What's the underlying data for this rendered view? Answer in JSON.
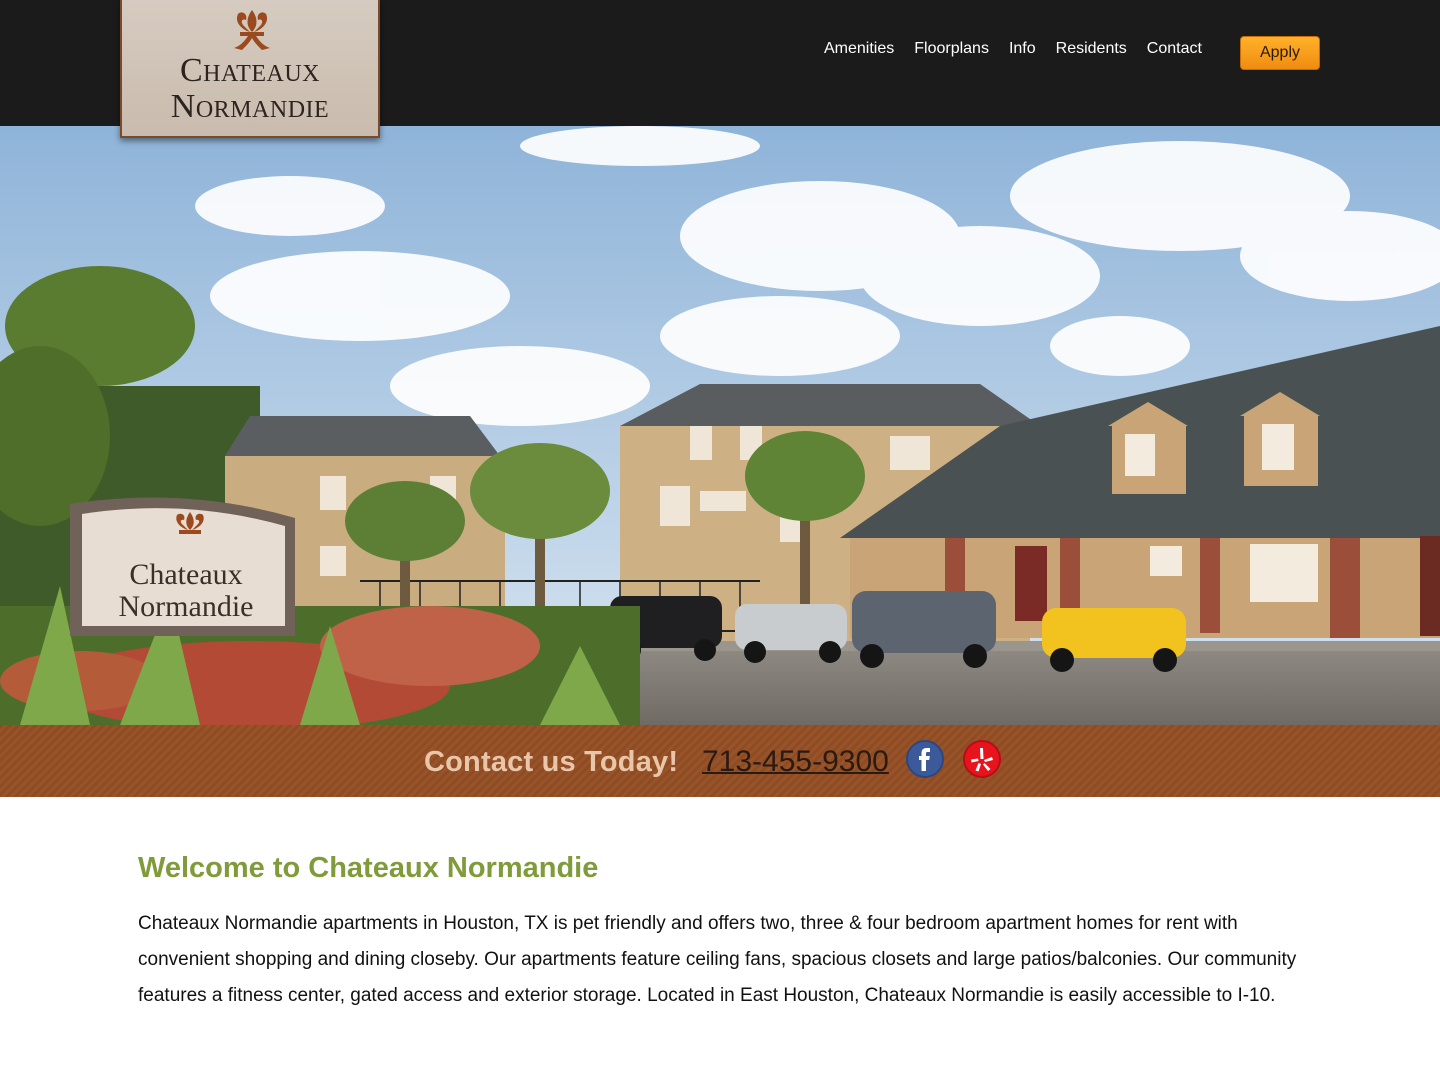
{
  "header": {
    "logo": {
      "line1": "Chateaux",
      "line2": "Normandie"
    },
    "nav": [
      {
        "label": "Amenities"
      },
      {
        "label": "Floorplans"
      },
      {
        "label": "Info"
      },
      {
        "label": "Residents"
      },
      {
        "label": "Contact"
      }
    ],
    "apply_label": "Apply"
  },
  "hero": {
    "sign_line1": "Chateaux",
    "sign_line2": "Normandie"
  },
  "contact": {
    "text": "Contact us Today!",
    "phone": "713-455-9300",
    "social": [
      {
        "icon": "facebook-icon"
      },
      {
        "icon": "yelp-icon"
      }
    ]
  },
  "main": {
    "title": "Welcome to Chateaux Normandie",
    "body": "Chateaux Normandie apartments in Houston, TX is pet friendly and offers two, three & four bedroom apartment homes for rent with convenient shopping and dining closeby. Our apartments feature ceiling fans, spacious closets and large patios/balconies. Our community features a fitness center, gated access and exterior storage. Located in East Houston, Chateaux Normandie is easily accessible to I-10."
  },
  "colors": {
    "header_bg": "#1b1b1b",
    "apply_orange": "#f7a21b",
    "strip_brown": "#934f25",
    "title_green": "#7f9b3a"
  }
}
